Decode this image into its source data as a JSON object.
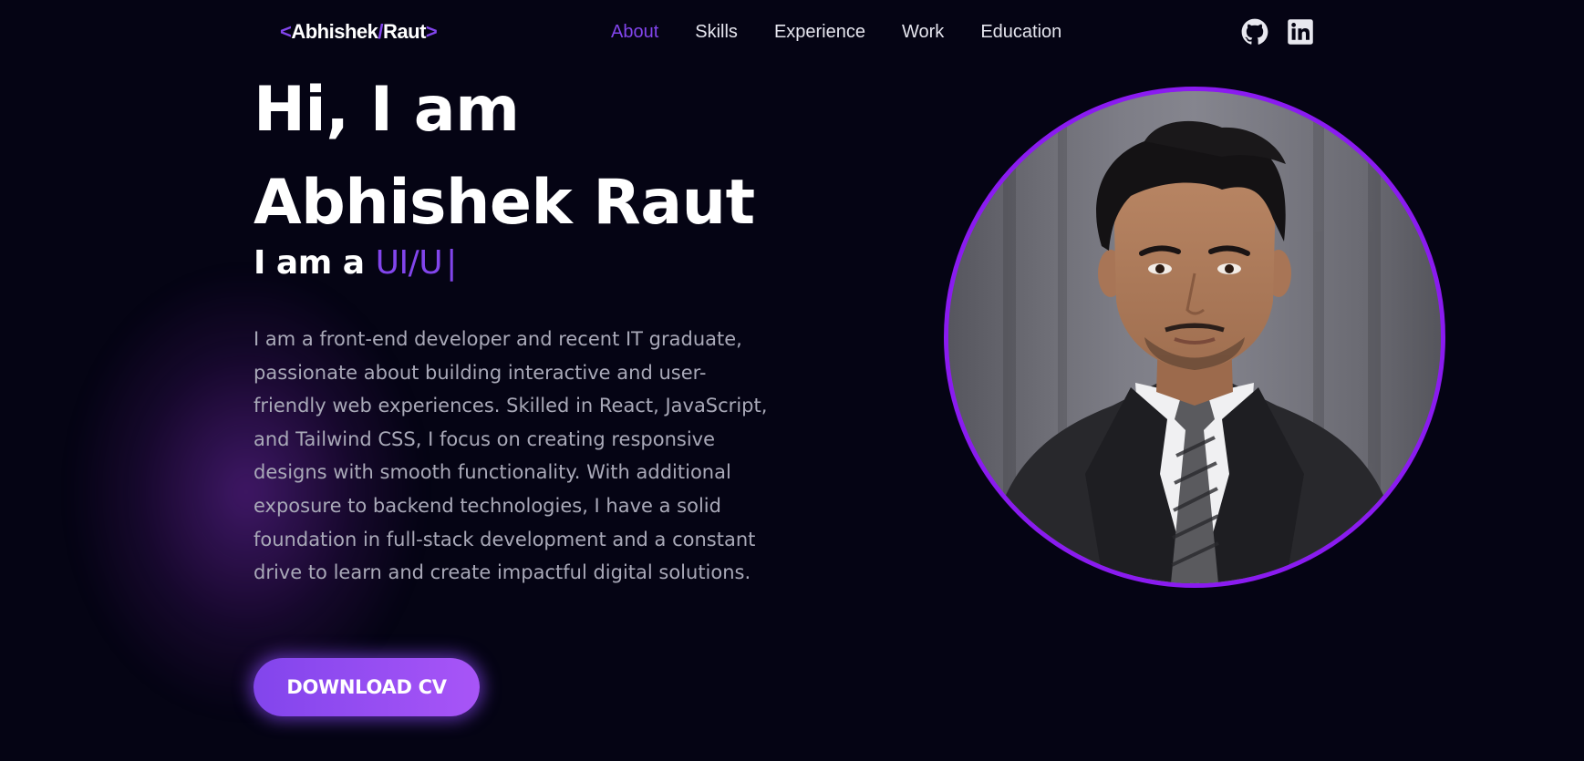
{
  "nav": {
    "logo": {
      "open": "<",
      "first": "Abhishek",
      "slash": "/",
      "last": "Raut",
      "close": ">"
    },
    "links": [
      {
        "label": "About",
        "active": true
      },
      {
        "label": "Skills",
        "active": false
      },
      {
        "label": "Experience",
        "active": false
      },
      {
        "label": "Work",
        "active": false
      },
      {
        "label": "Education",
        "active": false
      }
    ],
    "social": [
      {
        "icon": "github-icon"
      },
      {
        "icon": "linkedin-icon"
      }
    ]
  },
  "hero": {
    "greeting": "Hi, I am",
    "name": "Abhishek Raut",
    "role_prefix": "I am a",
    "role_typed": "UI/U",
    "cursor": "|",
    "bio": "I am a front-end developer and recent IT graduate, passionate about building interactive and user-friendly web experiences. Skilled in React, JavaScript, and Tailwind CSS, I focus on creating responsive designs with smooth functionality. With additional exposure to backend technologies, I have a solid foundation in full-stack development and a constant drive to learn and create impactful digital solutions.",
    "cta_label": "DOWNLOAD CV"
  },
  "colors": {
    "background": "#050414",
    "accent": "#8245ec",
    "portrait_border": "#8a1bf0",
    "body_text": "#a9a9b8"
  }
}
